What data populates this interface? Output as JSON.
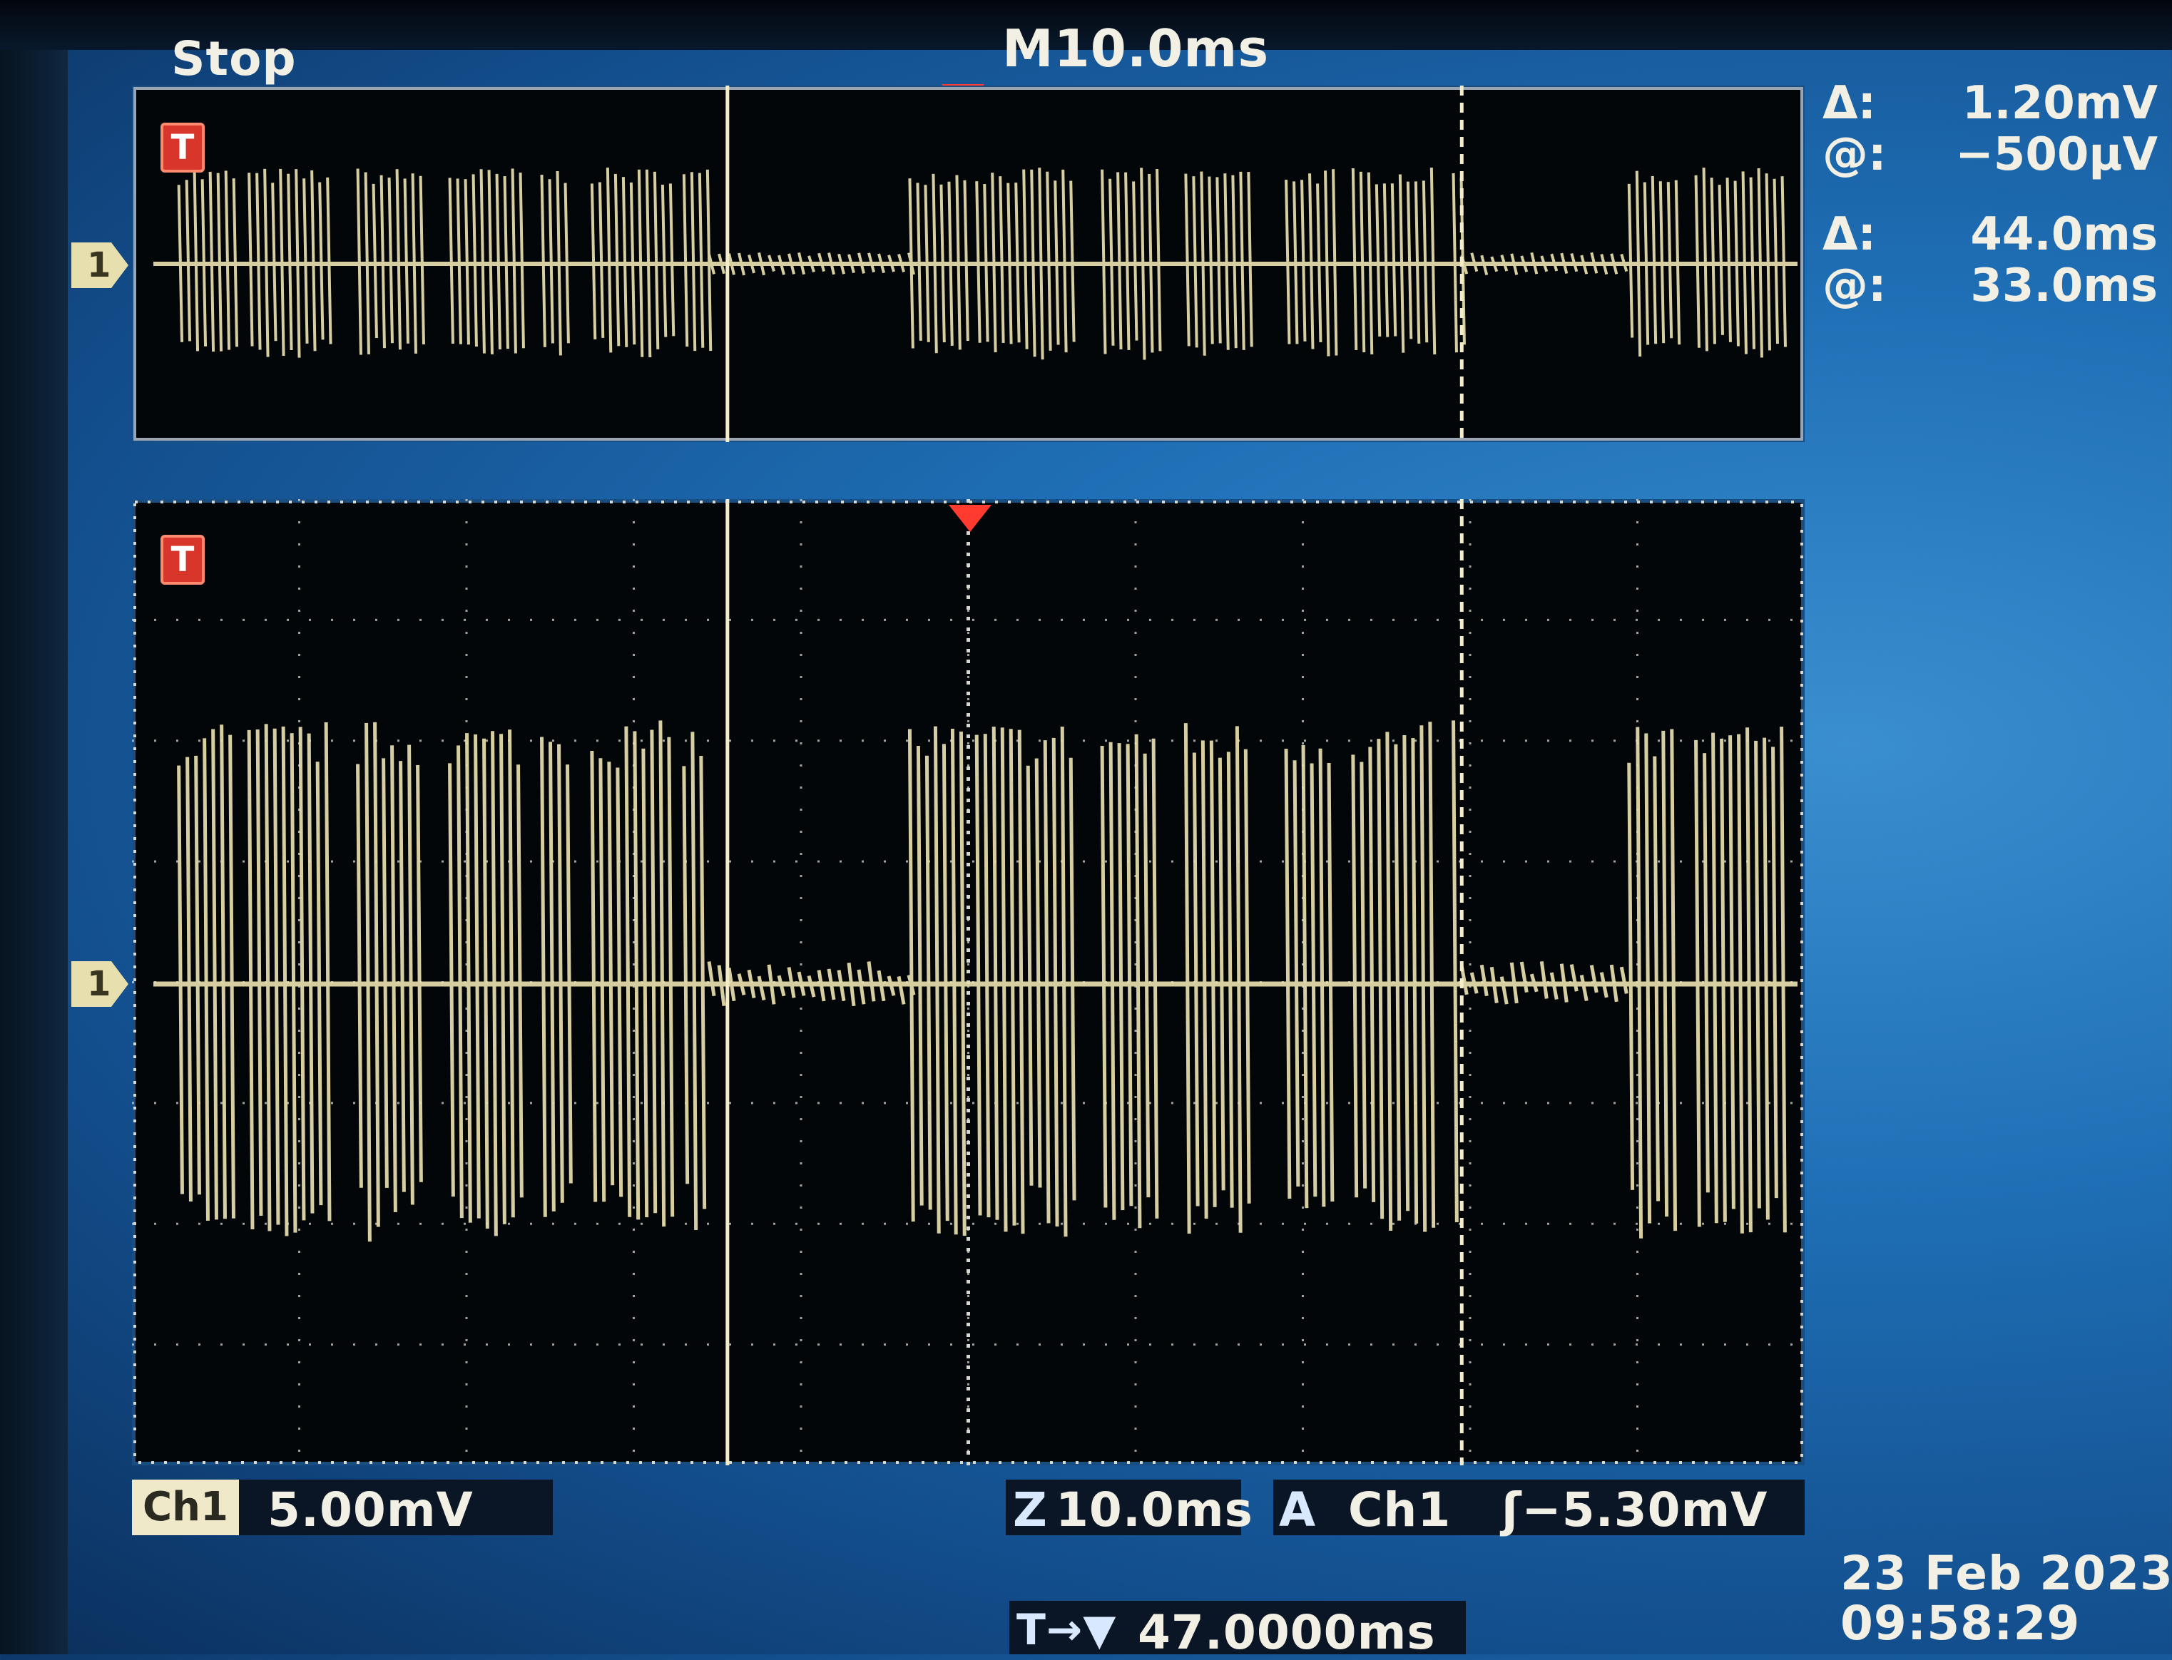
{
  "status": {
    "acquisition": "Stop"
  },
  "horizontal": {
    "main_timebase": "M10.0ms"
  },
  "channel": {
    "name": "Ch1",
    "marker": "1",
    "scale": "5.00mV",
    "trace_color": "#e8dfae"
  },
  "trigger": {
    "icon_label": "T",
    "icon_color": "#d8352b",
    "mode_letter": "A",
    "source": "Ch1",
    "level": "ʃ−5.30mV"
  },
  "zoom": {
    "letter": "Z",
    "scale": "10.0ms"
  },
  "cursors": {
    "voltage": {
      "delta_symbol": "Δ:",
      "delta": "1.20mV",
      "at_symbol": "@:",
      "at": "−500µV"
    },
    "time": {
      "delta_symbol": "Δ:",
      "delta": "44.0ms",
      "at_symbol": "@:",
      "at": "33.0ms"
    }
  },
  "horizontal_position": {
    "icon": "T→▼",
    "value": "47.0000ms"
  },
  "datetime": {
    "date": "23 Feb 2023",
    "time": "09:58:29"
  }
}
